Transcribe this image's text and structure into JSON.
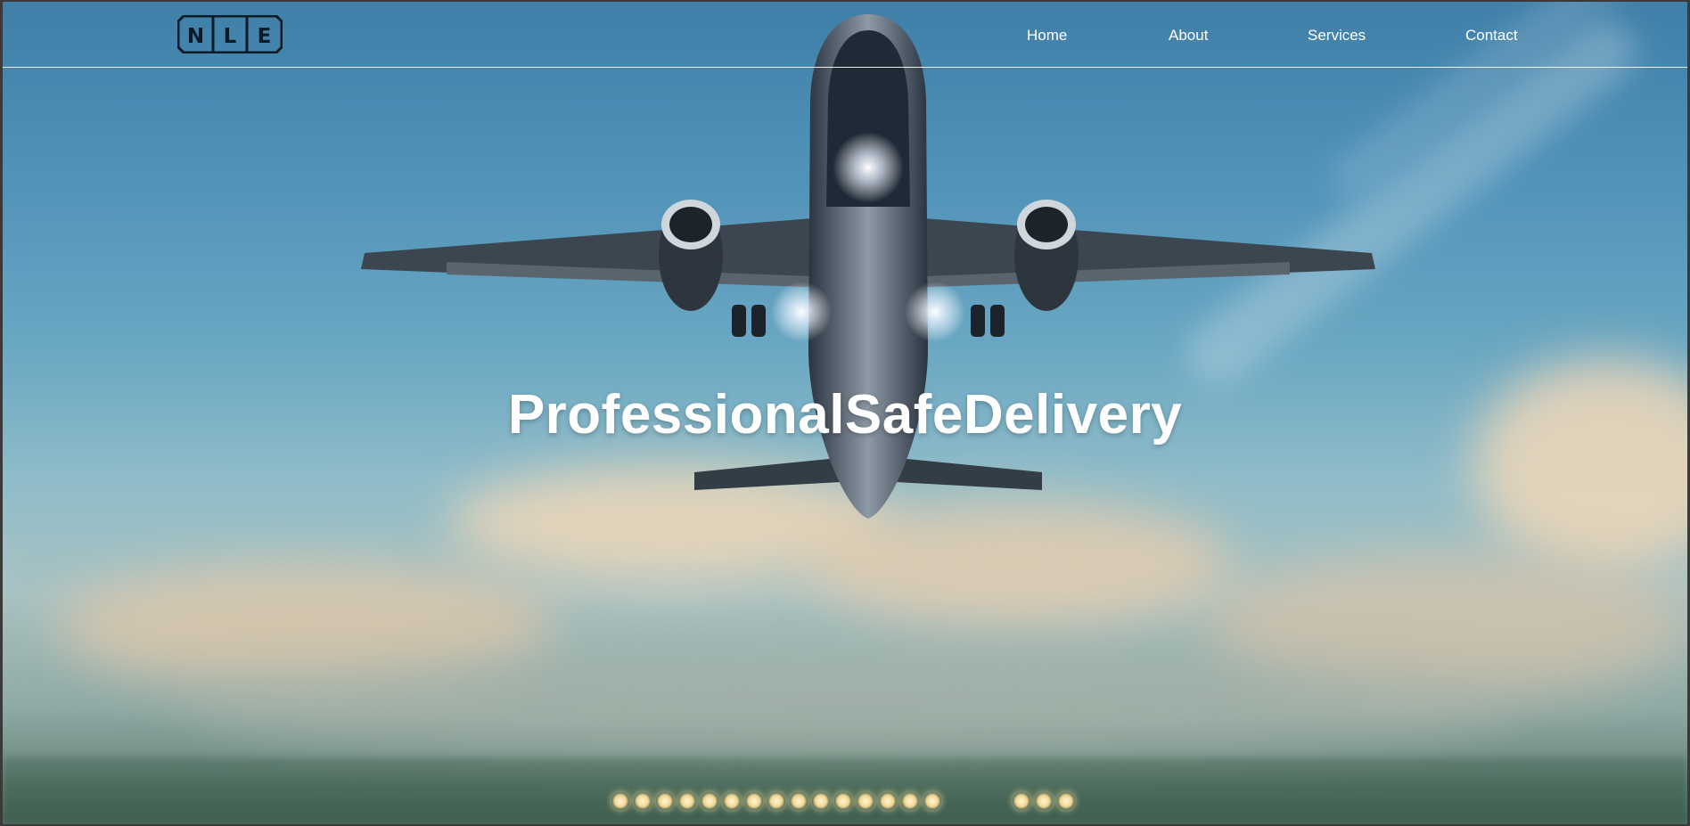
{
  "brand": {
    "logo_letters": [
      "N",
      "L",
      "E"
    ],
    "logo_color": "#0d1b27"
  },
  "nav": {
    "items": [
      {
        "label": "Home"
      },
      {
        "label": "About"
      },
      {
        "label": "Services"
      },
      {
        "label": "Contact"
      }
    ]
  },
  "hero": {
    "title": "ProfessionalSafeDelivery",
    "background": "airplane-takeoff-photo"
  },
  "colors": {
    "nav_text": "#ffffff",
    "sky_top": "#3f7fa8",
    "sky_bottom": "#8fbcc9"
  }
}
